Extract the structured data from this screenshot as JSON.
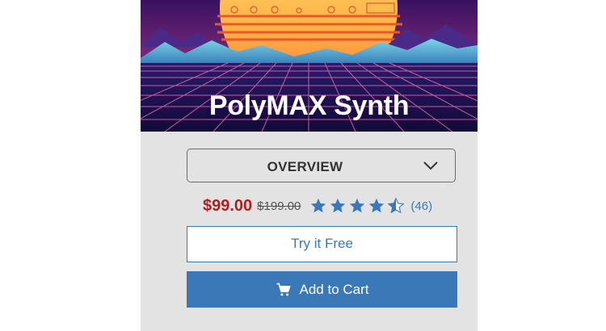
{
  "product": {
    "title": "PolyMAX Synth"
  },
  "overview_select": {
    "selected": "OVERVIEW",
    "icon": "chevron-down-icon"
  },
  "pricing": {
    "sale_price": "$99.00",
    "original_price": "$199.00",
    "sale_color": "#b01e1e"
  },
  "rating": {
    "stars": 4.5,
    "max": 5,
    "review_count": "(46)",
    "star_color": "#3a78b8"
  },
  "actions": {
    "try_label": "Try it Free",
    "cart_label": "Add to Cart",
    "cart_icon": "shopping-cart-icon",
    "accent": "#3a78b8"
  }
}
